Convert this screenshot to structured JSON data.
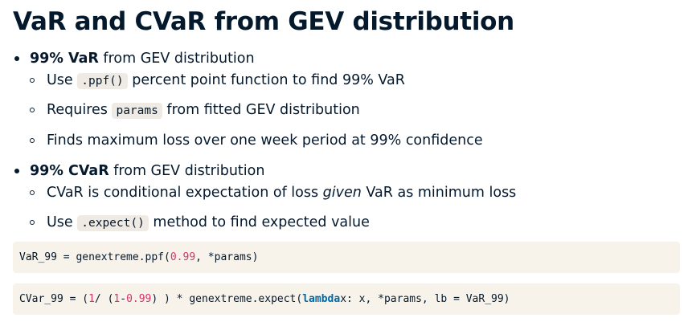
{
  "title": "VaR and CVaR from GEV distribution",
  "bullets": [
    {
      "bold": "99% VaR",
      "rest": " from GEV distribution",
      "sub": [
        {
          "pre": "Use ",
          "code": ".ppf()",
          "post": " percent point function to find 99% VaR"
        },
        {
          "pre": "Requires ",
          "code": "params",
          "post": " from fitted GEV distribution"
        },
        {
          "text": "Finds maximum loss over one week period at 99% confidence"
        }
      ]
    },
    {
      "bold": "99% CVaR",
      "rest": " from GEV distribution",
      "sub": [
        {
          "pre": "CVaR is conditional expectation of loss ",
          "italic": "given",
          "post": " VaR as minimum loss"
        },
        {
          "pre": "Use ",
          "code": ".expect()",
          "post": " method to find expected value"
        }
      ]
    }
  ],
  "code1": {
    "a": "VaR_99 = genextreme.ppf(",
    "n1": "0.99",
    "b": ", *params)"
  },
  "code2": {
    "a": "CVar_99 = ( ",
    "n1": "1",
    "b": " / (",
    "n2": "1",
    "c": " - ",
    "n3": "0.99",
    "d": ") ) * genextreme.expect(",
    "kw": "lambda",
    "e": " x: x, *params, lb = VaR_99)"
  }
}
